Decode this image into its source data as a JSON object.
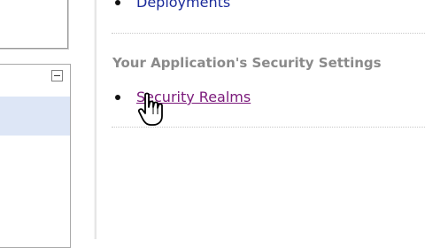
{
  "sidebar": {
    "collapse_symbol": "−"
  },
  "main": {
    "top_item": {
      "label": "Deployments"
    },
    "section_title": "Your Application's Security Settings",
    "security_item": {
      "label": "Security Realms"
    }
  },
  "cursor": {
    "icon": "hand-pointer-icon"
  },
  "colors": {
    "link": "#1a2a9a",
    "visited_link": "#7b1a7b",
    "section_title": "#8a8a8a",
    "selected_row": "#dde6f6"
  }
}
